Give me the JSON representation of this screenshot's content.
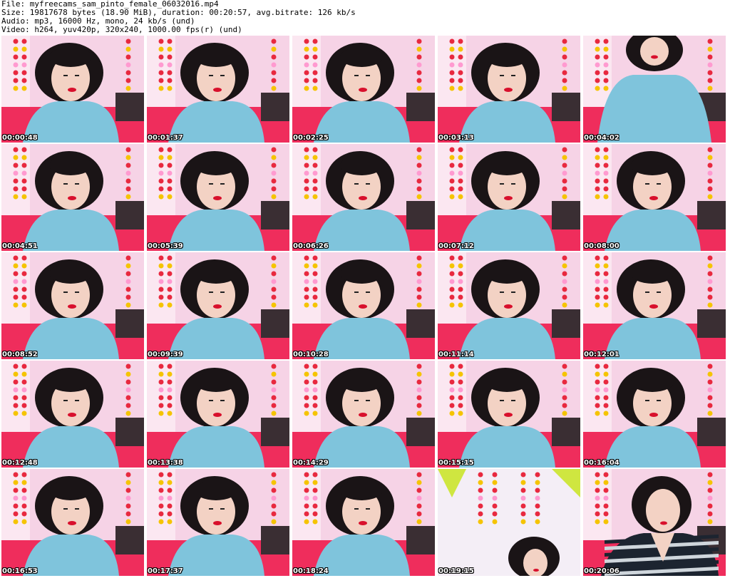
{
  "header": {
    "file": "File: myfreecams_sam_pinto_female_06032016.mp4",
    "size": "Size: 19817678 bytes (18.90 MiB), duration: 00:20:57, avg.bitrate: 126 kb/s",
    "audio": "Audio: mp3, 16000 Hz, mono, 24 kb/s (und)",
    "video": "Video: h264, yuv420p, 320x240, 1000.00 fps(r) (und)"
  },
  "thumbnails": [
    {
      "time": "00:00:48",
      "variant": "a"
    },
    {
      "time": "00:01:37",
      "variant": "a"
    },
    {
      "time": "00:02:25",
      "variant": "a"
    },
    {
      "time": "00:03:13",
      "variant": "a"
    },
    {
      "time": "00:04:02",
      "variant": "b"
    },
    {
      "time": "00:04:51",
      "variant": "a"
    },
    {
      "time": "00:05:39",
      "variant": "a"
    },
    {
      "time": "00:06:26",
      "variant": "a"
    },
    {
      "time": "00:07:12",
      "variant": "a"
    },
    {
      "time": "00:08:00",
      "variant": "a"
    },
    {
      "time": "00:08:52",
      "variant": "a"
    },
    {
      "time": "00:09:39",
      "variant": "a"
    },
    {
      "time": "00:10:28",
      "variant": "a"
    },
    {
      "time": "00:11:14",
      "variant": "a"
    },
    {
      "time": "00:12:01",
      "variant": "a"
    },
    {
      "time": "00:12:48",
      "variant": "a"
    },
    {
      "time": "00:13:38",
      "variant": "a"
    },
    {
      "time": "00:14:29",
      "variant": "a"
    },
    {
      "time": "00:15:15",
      "variant": "a"
    },
    {
      "time": "00:16:04",
      "variant": "a"
    },
    {
      "time": "00:16:53",
      "variant": "a"
    },
    {
      "time": "00:17:37",
      "variant": "a"
    },
    {
      "time": "00:18:24",
      "variant": "c"
    },
    {
      "time": "00:19:15",
      "variant": "d"
    },
    {
      "time": "00:20:06",
      "variant": "e"
    }
  ],
  "colors": {
    "wall": "#f6d3e6",
    "bed": "#ef2d5c",
    "shirt": "#7fc4dc",
    "hair": "#1a1416",
    "skin": "#f3d2c4",
    "lips": "#d8102c"
  }
}
